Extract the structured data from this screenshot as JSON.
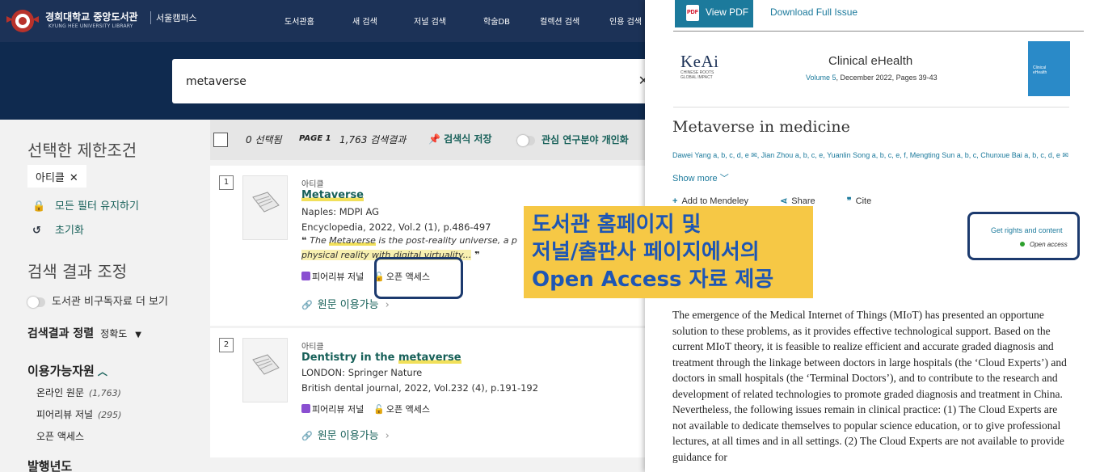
{
  "library": {
    "name_ko": "경희대학교 중앙도서관",
    "name_en": "KYUNG HEE UNIVERSITY LIBRARY",
    "campus": "서울캠퍼스",
    "nav": [
      "도서관홈",
      "새 검색",
      "저널 검색",
      "학술DB",
      "컬렉션 검색",
      "인용 검색"
    ],
    "search_query": "metaverse",
    "sidebar": {
      "filters_title": "선택한 제한조건",
      "chip": "아티클",
      "keep_filters": "모든 필터 유지하기",
      "reset": "초기화",
      "refine_title": "검색 결과 조정",
      "toggle_label": "도서관 비구독자료 더 보기",
      "sort_label": "검색결과 정렬",
      "sort_value": "정확도",
      "availability_title": "이용가능자원",
      "availability_items": [
        {
          "label": "온라인 원문",
          "count": "(1,763)"
        },
        {
          "label": "피어리뷰 저널",
          "count": "(295)"
        },
        {
          "label": "오픈 액세스",
          "count": ""
        }
      ],
      "pubyear_title": "발행년도"
    },
    "toolbar": {
      "selected": "0 선택됨",
      "page": "PAGE 1",
      "count": "1,763 검색결과",
      "save": "검색식 저장",
      "personalize": "관심 연구분야 개인화"
    },
    "results": [
      {
        "num": "1",
        "type": "아티클",
        "title": "Metaverse",
        "publisher": "Naples: MDPI AG",
        "source": "Encyclopedia, 2022, Vol.2 (1), p.486-497",
        "quote_a": "The ",
        "quote_hl": "Metaverse",
        "quote_b": " is the post-reality universe, a p",
        "quote_line2": "physical reality with digital virtuality...",
        "peer": "피어리뷰 저널",
        "oa": "오픈 액세스",
        "fulltext": "원문 이용가능"
      },
      {
        "num": "2",
        "type": "아티클",
        "title_a": "Dentistry in the ",
        "title_hl": "metaverse",
        "publisher": "LONDON: Springer Nature",
        "source": "British dental journal, 2022, Vol.232 (4), p.191-192",
        "peer": "피어리뷰 저널",
        "oa": "오픈 액세스",
        "fulltext": "원문 이용가능"
      }
    ]
  },
  "article": {
    "view_pdf": "View PDF",
    "download_issue": "Download Full Issue",
    "publisher_logo": "KeAi",
    "publisher_tagline": "CHINESE ROOTS GLOBAL IMPACT",
    "journal": "Clinical eHealth",
    "volume_link": "Volume 5",
    "volume_rest": ", December 2022, Pages 39-43",
    "cover_text": "Clinical eHealth",
    "title": "Metaverse in medicine",
    "authors": "Dawei Yang a, b, c, d, e ✉, Jian Zhou a, b, c, e, Yuanlin Song a, b, c, e, f, Mengting Sun a, b, c, Chunxue Bai a, b, c, d, e ✉",
    "show_more": "Show more",
    "add_mendeley": "Add to Mendeley",
    "share": "Share",
    "cite": "Cite",
    "rights": "Get rights and content",
    "open_access": "Open access",
    "abstract": "The emergence of the Medical Internet of Things (MIoT) has presented an opportune solution to these problems, as it provides effective technological support. Based on the current MIoT theory, it is feasible to realize efficient and accurate graded diagnosis and treatment through the linkage between doctors in large hospitals (the ‘Cloud Experts’) and doctors in small hospitals (the ‘Terminal Doctors’), and to contribute to the research and development of related technologies to promote graded diagnosis and treatment in China. Nevertheless, the following issues remain in clinical practice: (1) The Cloud Experts are not available to dedicate themselves to popular science education, or to give professional lectures, at all times and in all settings. (2) The Cloud Experts are not available to provide guidance for"
  },
  "callout": {
    "line1": "도서관 홈페이지 및",
    "line2": "저널/출판사 페이지에서의",
    "line3": "Open Access 자료 제공"
  },
  "colors": {
    "navy": "#1c3257",
    "teal": "#176059",
    "link_blue": "#1c7a9c",
    "callout_bg": "#f6c845",
    "callout_text": "#1e56b4",
    "highlight_border": "#1c3a6e"
  }
}
